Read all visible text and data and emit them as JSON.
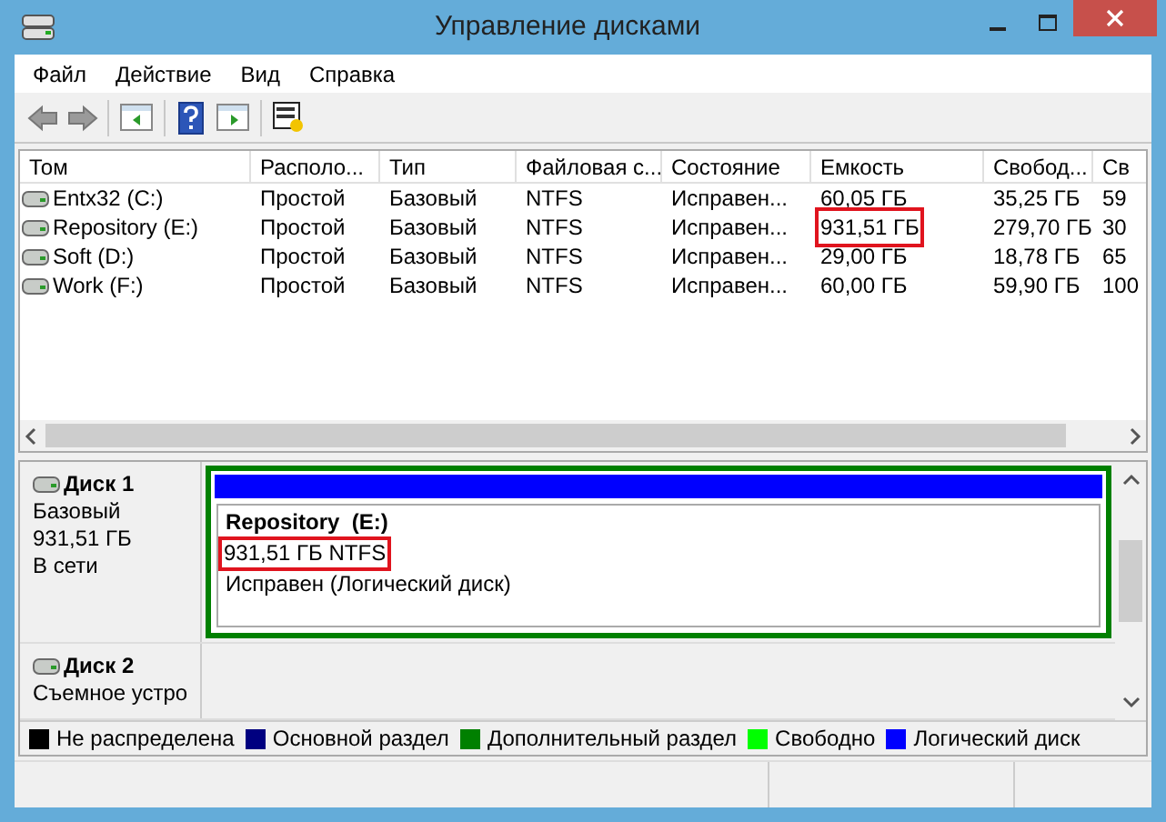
{
  "window": {
    "title": "Управление дисками"
  },
  "menu": [
    "Файл",
    "Действие",
    "Вид",
    "Справка"
  ],
  "toolbar": [
    {
      "kind": "back"
    },
    {
      "kind": "forward"
    },
    {
      "kind": "sep"
    },
    {
      "kind": "panel"
    },
    {
      "kind": "sep"
    },
    {
      "kind": "help"
    },
    {
      "kind": "panel2"
    },
    {
      "kind": "sep"
    },
    {
      "kind": "props"
    }
  ],
  "table": {
    "columns": [
      "Том",
      "Располо...",
      "Тип",
      "Файловая с...",
      "Состояние",
      "Емкость",
      "Свобод...",
      "Св"
    ],
    "rows": [
      {
        "cells": [
          "Entx32 (C:)",
          "Простой",
          "Базовый",
          "NTFS",
          "Исправен...",
          "60,05 ГБ",
          "35,25 ГБ",
          "59"
        ],
        "capacity_highlighted": false
      },
      {
        "cells": [
          "Repository (E:)",
          "Простой",
          "Базовый",
          "NTFS",
          "Исправен...",
          "931,51 ГБ",
          "279,70 ГБ",
          "30"
        ],
        "capacity_highlighted": true
      },
      {
        "cells": [
          "Soft (D:)",
          "Простой",
          "Базовый",
          "NTFS",
          "Исправен...",
          "29,00 ГБ",
          "18,78 ГБ",
          "65"
        ],
        "capacity_highlighted": false
      },
      {
        "cells": [
          "Work (F:)",
          "Простой",
          "Базовый",
          "NTFS",
          "Исправен...",
          "60,00 ГБ",
          "59,90 ГБ",
          "100"
        ],
        "capacity_highlighted": false
      }
    ]
  },
  "disks": [
    {
      "name": "Диск 1",
      "lines": [
        "Базовый",
        "931,51 ГБ",
        "В сети"
      ],
      "partition": {
        "name": "Repository  (E:)",
        "size": "931,51 ГБ NTFS",
        "size_highlighted": true,
        "status": "Исправен (Логический диск)",
        "color": "#0000ff"
      }
    },
    {
      "name": "Диск 2",
      "lines": [
        "Съемное устро"
      ]
    }
  ],
  "legend": [
    {
      "label": "Не распределена",
      "color": "#000000"
    },
    {
      "label": "Основной раздел",
      "color": "#000080"
    },
    {
      "label": "Дополнительный раздел",
      "color": "#008000"
    },
    {
      "label": "Свободно",
      "color": "#00ff00"
    },
    {
      "label": "Логический диск",
      "color": "#0000ff"
    }
  ]
}
